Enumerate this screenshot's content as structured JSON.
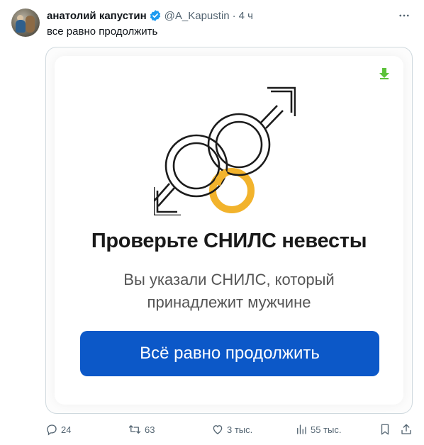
{
  "tweet": {
    "author_name": "анатолий капустин",
    "handle": "@A_Kapustin",
    "separator": "·",
    "time": "4 ч",
    "text": "все равно продолжить"
  },
  "card": {
    "title": "Проверьте СНИЛС невесты",
    "subtitle_line1": "Вы указали СНИЛС, который",
    "subtitle_line2": "принадлежит мужчине",
    "button_label": "Всё равно продолжить",
    "button_color": "#0c58c8",
    "ring_color": "#f2b32c",
    "download_icon_color": "#5cc23a"
  },
  "actions": {
    "replies": "24",
    "reposts": "63",
    "likes": "3 тыс.",
    "views": "55 тыс."
  },
  "icons": {
    "verified": "verified-badge-icon",
    "more": "more-dots-icon",
    "reply": "reply-icon",
    "repost": "repost-icon",
    "like": "heart-icon",
    "views": "views-chart-icon",
    "bookmark": "bookmark-icon",
    "share": "share-icon",
    "download": "download-arrow-icon",
    "illustration": "linked-male-symbols-rings-icon"
  }
}
